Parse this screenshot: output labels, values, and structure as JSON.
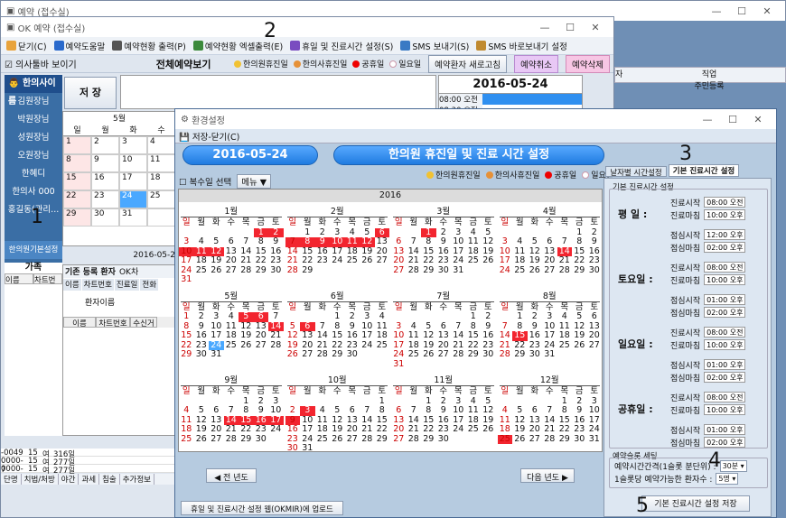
{
  "bg_window": {
    "title": "OK 예약 (접수실)",
    "title_back": "예약 (접수실)"
  },
  "main": {
    "toolbar": [
      "닫기(C)",
      "예약도움말",
      "예약현황 출력(P)",
      "예약현황 엑셀출력(E)",
      "휴일 및 진료시간 설정(S)",
      "SMS 보내기(S)",
      "SMS 바로보내기 설정"
    ],
    "show_toolbar": "의사툴바 보이기",
    "heading": "전체예약보기",
    "legend": [
      "한의원휴진일",
      "한의사휴진일",
      "공휴일",
      "일요일"
    ],
    "refresh_btn": "예약환자 새로고침",
    "cancel_btn": "예약취소",
    "delete_btn": "예약삭제",
    "save_btn": "저 장",
    "date_header": "2016-05-24",
    "times": [
      "08:00 오전",
      "08:30 오전"
    ],
    "doctor_header": "한의사이름",
    "doctors": [
      "김원장님",
      "박원장님",
      "성원장님",
      "오원장님",
      "한혜디",
      "한의사 000",
      "홍길동(관리..."
    ],
    "basic_setting": "한의원기본설정",
    "mini_month": "5월",
    "mini_year": "2016",
    "mini_footer": "2016-05-2",
    "mini_rows": [
      [
        "1",
        "2",
        "3",
        "4"
      ],
      [
        "8",
        "9",
        "10",
        "11"
      ],
      [
        "15",
        "16",
        "17",
        "18"
      ],
      [
        "22",
        "23",
        "24",
        "25"
      ],
      [
        "29",
        "30",
        "31",
        ""
      ]
    ],
    "mini_days": [
      "일",
      "월",
      "화",
      "수"
    ],
    "family": "가족",
    "family_cols": [
      "이름",
      "차트번"
    ],
    "patient_tab": "기존 등록 환자",
    "patient_tab2": "OK차",
    "patient_subtabs": [
      "이름",
      "차트번호",
      "진료일",
      "전화"
    ],
    "patient_name_label": "환자이름",
    "patient_cols": [
      "이름",
      "차트번호",
      "수신거"
    ],
    "bottom_rows": [
      [
        "-0049",
        "15",
        "여",
        "316일"
      ],
      [
        "0000-7",
        "15",
        "여",
        "277일"
      ],
      [
        "0000-9",
        "15",
        "여",
        "277일"
      ]
    ],
    "bottom_tabs": [
      "단명",
      "치법/처방",
      "야간",
      "과세",
      "침술",
      "추가정보"
    ],
    "right_cols": [
      "직업",
      "주민등록"
    ],
    "right_col_left": "자"
  },
  "env": {
    "title": "환경설정",
    "save_close": "저장-닫기(C)",
    "date": "2016-05-24",
    "heading": "한의원 휴진일 및 진료 시간 설정",
    "tab_date": "날자별 시간설정",
    "tab_basic": "기본 진료시간 설정",
    "multi_select": "복수일 선택",
    "menu_btn": "메뉴 ▼",
    "year": "2016",
    "days": [
      "일",
      "월",
      "화",
      "수",
      "목",
      "금",
      "토"
    ],
    "prev_year": "전 년도",
    "next_year": "다음 년도",
    "upload_btn": "휴일 및 진료시간 설정 웹(OKMIR)에 업로드",
    "group_basic": "기본 진료시간 설정",
    "sections": [
      {
        "label": "평 일 :",
        "start": "08:00 오전",
        "end": "10:00 오후",
        "lunch_s": "12:00 오후",
        "lunch_e": "02:00 오후"
      },
      {
        "label": "토요일 :",
        "start": "08:00 오전",
        "end": "10:00 오후",
        "lunch_s": "01:00 오후",
        "lunch_e": "02:00 오후"
      },
      {
        "label": "일요일 :",
        "start": "08:00 오전",
        "end": "10:00 오후",
        "lunch_s": "01:00 오후",
        "lunch_e": "02:00 오후"
      },
      {
        "label": "공휴일 :",
        "start": "08:00 오전",
        "end": "10:00 오후",
        "lunch_s": "01:00 오후",
        "lunch_e": "02:00 오후"
      }
    ],
    "lbl_start": "진료시작",
    "lbl_end": "진료마침",
    "lbl_lunch_s": "점심시작",
    "lbl_lunch_e": "점심마침",
    "slot_group": "예약슬롯 세팅",
    "slot_interval_label": "예약시간간격(1슬롯 분단위) :",
    "slot_interval": "30분",
    "slot_count_label": "1슬롯당 예약가능한 환자수 :",
    "slot_count": "5명",
    "save_basic": "기본 진료시간 설정 저장"
  },
  "annotations": [
    "1",
    "2",
    "3",
    "4",
    "5"
  ],
  "months": [
    {
      "name": "1월",
      "start": 5,
      "len": 31,
      "red": [
        1,
        2,
        10,
        11,
        12
      ]
    },
    {
      "name": "2월",
      "start": 1,
      "len": 29,
      "red": [
        6,
        7,
        8,
        9,
        10,
        11,
        12
      ]
    },
    {
      "name": "3월",
      "start": 2,
      "len": 31,
      "red": [
        1
      ]
    },
    {
      "name": "4월",
      "start": 5,
      "len": 30,
      "red": [
        14
      ]
    },
    {
      "name": "5월",
      "start": 0,
      "len": 31,
      "red": [
        5,
        6,
        14
      ],
      "sel": [
        24
      ]
    },
    {
      "name": "6월",
      "start": 3,
      "len": 30,
      "red": [
        6
      ]
    },
    {
      "name": "7월",
      "start": 5,
      "len": 31,
      "red": []
    },
    {
      "name": "8월",
      "start": 1,
      "len": 31,
      "red": [
        15
      ]
    },
    {
      "name": "9월",
      "start": 4,
      "len": 30,
      "red": [
        14,
        15,
        16,
        17
      ]
    },
    {
      "name": "10월",
      "start": 6,
      "len": 31,
      "red": [
        3,
        9
      ]
    },
    {
      "name": "11월",
      "start": 2,
      "len": 30,
      "red": []
    },
    {
      "name": "12월",
      "start": 4,
      "len": 31,
      "red": [
        25
      ]
    }
  ],
  "colors": {
    "red": "#f2252f",
    "selected": "#4aa8ff",
    "window_bg": "#b6cbe0",
    "panel": "#dde7f2"
  }
}
